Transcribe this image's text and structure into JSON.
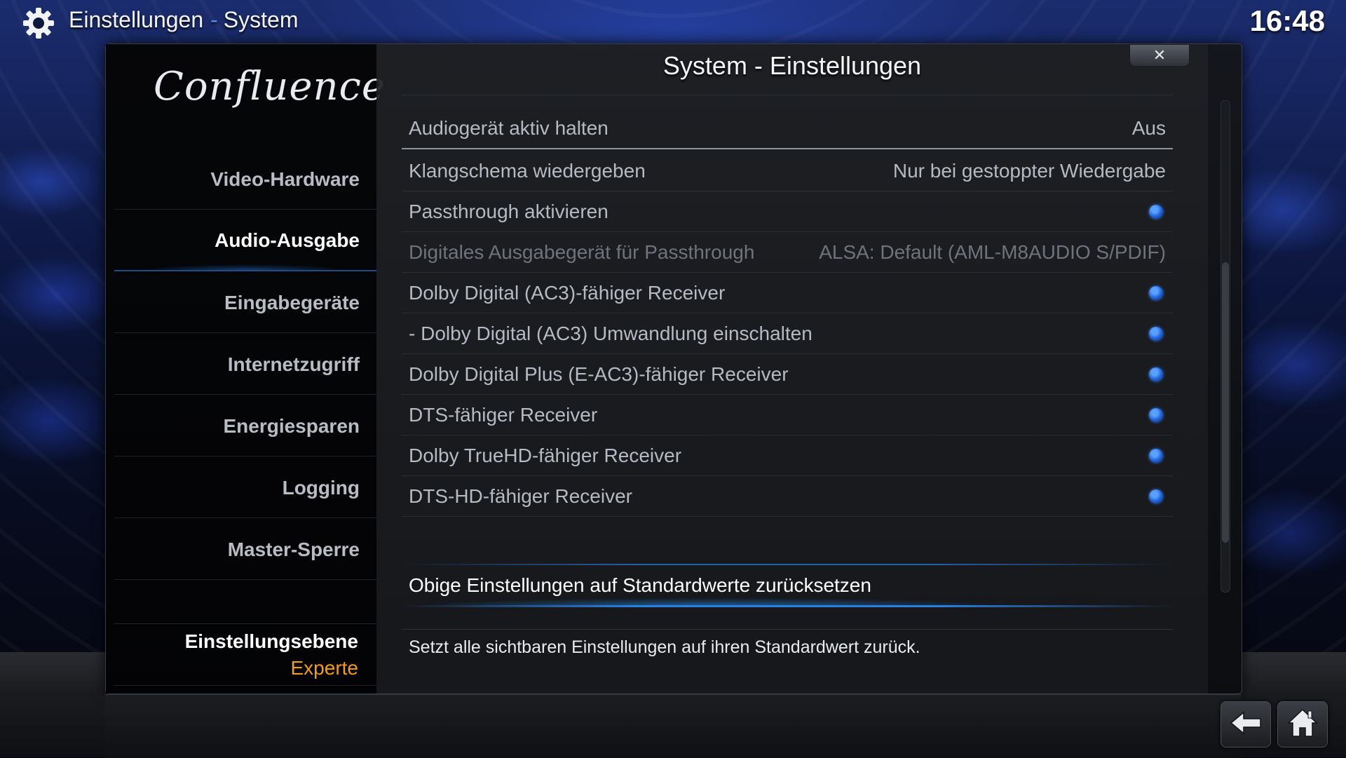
{
  "header": {
    "section": "Einstellungen",
    "separator": "-",
    "page": "System",
    "clock": "16:48"
  },
  "window": {
    "title": "System - Einstellungen",
    "close_label": "✕"
  },
  "logo": "Confluence",
  "sidebar": {
    "items": [
      {
        "label": "Video-Hardware"
      },
      {
        "label": "Audio-Ausgabe"
      },
      {
        "label": "Eingabegeräte"
      },
      {
        "label": "Internetzugriff"
      },
      {
        "label": "Energiesparen"
      },
      {
        "label": "Logging"
      },
      {
        "label": "Master-Sperre"
      }
    ],
    "active_index": 1,
    "settings_level_label": "Einstellungsebene",
    "settings_level_value": "Experte"
  },
  "settings": [
    {
      "label": "Audiogerät aktiv halten",
      "value": "Aus",
      "type": "text"
    },
    {
      "label": "Klangschema wiedergeben",
      "value": "Nur bei gestoppter Wiedergabe",
      "type": "text"
    },
    {
      "label": "Passthrough aktivieren",
      "type": "radio",
      "enabled": true
    },
    {
      "label": "Digitales Ausgabegerät für Passthrough",
      "value": "ALSA: Default (AML-M8AUDIO S/PDIF)",
      "type": "text",
      "disabled": true
    },
    {
      "label": "Dolby Digital (AC3)-fähiger Receiver",
      "type": "radio",
      "enabled": true
    },
    {
      "label": "- Dolby Digital (AC3) Umwandlung einschalten",
      "type": "radio",
      "enabled": true
    },
    {
      "label": "Dolby Digital Plus (E-AC3)-fähiger Receiver",
      "type": "radio",
      "enabled": true
    },
    {
      "label": "DTS-fähiger Receiver",
      "type": "radio",
      "enabled": true
    },
    {
      "label": "Dolby TrueHD-fähiger Receiver",
      "type": "radio",
      "enabled": true
    },
    {
      "label": "DTS-HD-fähiger Receiver",
      "type": "radio",
      "enabled": true
    }
  ],
  "reset": {
    "label": "Obige Einstellungen auf Standardwerte zurücksetzen",
    "description": "Setzt alle sichtbaren Einstellungen auf ihren Standardwert zurück."
  },
  "icons": {
    "header": "gear-icon",
    "close": "close-icon",
    "back": "back-arrow-icon",
    "home": "home-icon"
  },
  "colors": {
    "accent": "#2a7fe0",
    "level_value": "#f39c1b",
    "radio_on": "#1f63d6"
  }
}
